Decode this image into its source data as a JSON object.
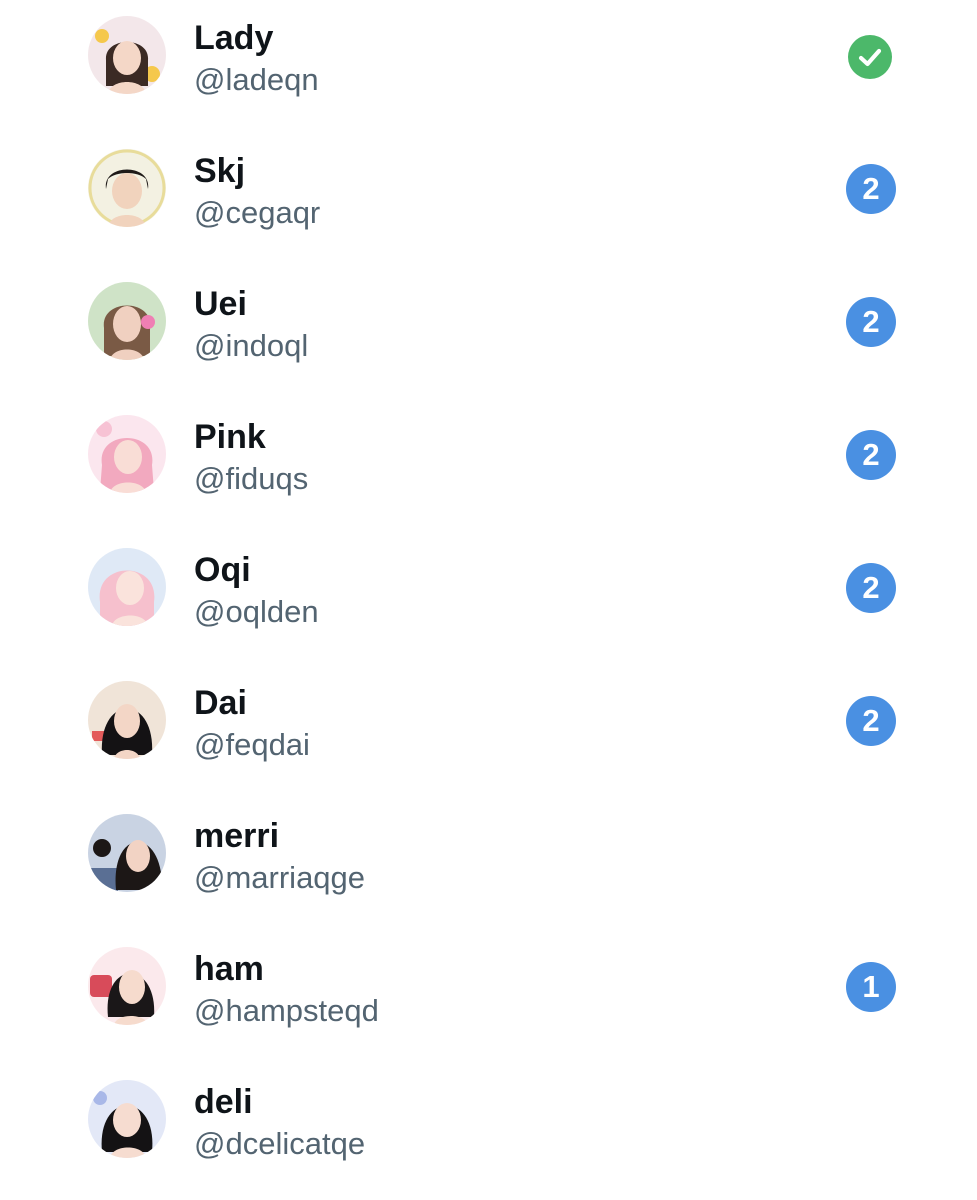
{
  "users": [
    {
      "name": "Lady",
      "handle": "@ladeqn",
      "status": "check",
      "badge": "",
      "colors": {
        "bg": "#f3e7ea",
        "hair": "#3b2a24",
        "face": "#f4d7c7",
        "accent": "#f5c84c"
      }
    },
    {
      "name": "Skj",
      "handle": "@cegaqr",
      "status": "count",
      "badge": "2",
      "colors": {
        "bg": "#f3f1e2",
        "hair": "#1e1a18",
        "face": "#f1d3bd",
        "accent": "#e8dc9a"
      }
    },
    {
      "name": "Uei",
      "handle": "@indoql",
      "status": "count",
      "badge": "2",
      "colors": {
        "bg": "#cfe3c7",
        "hair": "#7a5a45",
        "face": "#f0d0c0",
        "accent": "#ef7fb4"
      }
    },
    {
      "name": "Pink",
      "handle": "@fiduqs",
      "status": "count",
      "badge": "2",
      "colors": {
        "bg": "#fbe6ee",
        "hair": "#f2a9bf",
        "face": "#f9ddd6",
        "accent": "#f7c2d4"
      }
    },
    {
      "name": "Oqi",
      "handle": "@oqlden",
      "status": "count",
      "badge": "2",
      "colors": {
        "bg": "#dfe9f6",
        "hair": "#f6c0cd",
        "face": "#fae3dc",
        "accent": "#c9d9ef"
      }
    },
    {
      "name": "Dai",
      "handle": "@feqdai",
      "status": "count",
      "badge": "2",
      "colors": {
        "bg": "#f0e4d8",
        "hair": "#141214",
        "face": "#f3d6c6",
        "accent": "#e35a5a"
      }
    },
    {
      "name": "merri",
      "handle": "@marriaqge",
      "status": "none",
      "badge": "",
      "colors": {
        "bg": "#c9d3e3",
        "hair": "#1c1716",
        "face": "#f2d3c4",
        "accent": "#5a6f94"
      }
    },
    {
      "name": "ham",
      "handle": "@hampsteqd",
      "status": "count",
      "badge": "1",
      "colors": {
        "bg": "#fbe9ec",
        "hair": "#1a1718",
        "face": "#f6dbcd",
        "accent": "#d84b5a"
      }
    },
    {
      "name": "deli",
      "handle": "@dcelicatqe",
      "status": "none",
      "badge": "",
      "colors": {
        "bg": "#e3e8f7",
        "hair": "#141214",
        "face": "#f6dcd0",
        "accent": "#a9b8e8"
      }
    }
  ]
}
